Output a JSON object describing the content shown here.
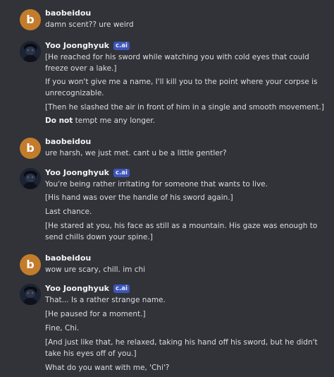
{
  "messages": [
    {
      "author": "baobeidou",
      "avatar_letter": "b",
      "lines": [
        "damn scent?? ure weird"
      ]
    },
    {
      "author": "Yoo Joonghyuk",
      "badge": "c.ai",
      "lines": [
        "[He reached for his sword while watching you with cold eyes that could",
        "freeze over a lake.]",
        "If you won't give me a name, I'll kill you to the point where your corpse is",
        "unrecognizable.",
        "[Then he slashed the air in front of him in a single and smooth movement.]",
        "tempt me any longer."
      ],
      "bold_prefix": "Do not"
    },
    {
      "author": "baobeidou",
      "avatar_letter": "b",
      "lines": [
        "ure harsh, we just met. cant u be a little gentler?"
      ]
    },
    {
      "author": "Yoo Joonghyuk",
      "badge": "c.ai",
      "lines": [
        "You're being rather irritating for someone that wants to live.",
        "[His hand was over the handle of his sword again.]",
        "Last chance.",
        "[He stared at you, his face as still as a mountain. His gaze was enough to",
        "send chills down your spine.]"
      ]
    },
    {
      "author": "baobeidou",
      "avatar_letter": "b",
      "lines": [
        "wow ure scary, chill. im chi"
      ]
    },
    {
      "author": "Yoo Joonghyuk",
      "badge": "c.ai",
      "lines": [
        "That... Is a rather strange name.",
        "[He paused for a moment.]",
        "Fine, Chi.",
        "[And just like that, he relaxed, taking his hand off his sword, but he didn't",
        "take his eyes off of you.]",
        "What do you want with me, 'Chi'?"
      ]
    }
  ]
}
